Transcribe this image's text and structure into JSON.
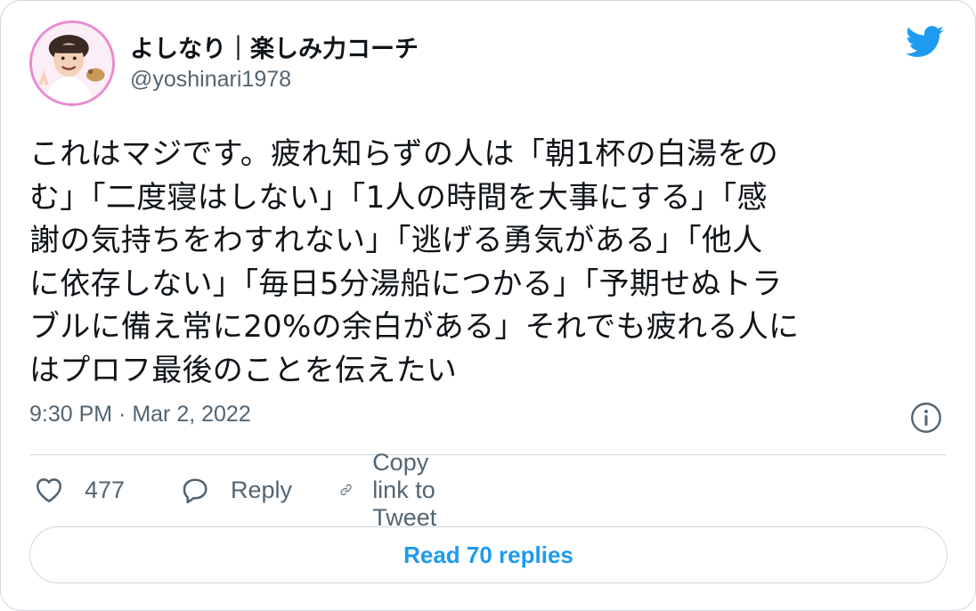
{
  "author": {
    "name": "よしなり｜楽しみ力コーチ",
    "handle": "@yoshinari1978"
  },
  "tweet": {
    "lines": [
      "これはマジです。疲れ知らずの人は「朝1杯の白湯をの",
      "む」「二度寝はしない」「1人の時間を大事にする」「感",
      "謝の気持ちをわすれない」「逃げる勇気がある」「他人",
      "に依存しない」「毎日5分湯船につかる」「予期せぬトラ",
      "ブルに備え常に20%の余白がある」それでも疲れる人に",
      "はプロフ最後のことを伝えたい"
    ],
    "timestamp": "9:30 PM · Mar 2, 2022"
  },
  "actions": {
    "like_count": "477",
    "reply_label": "Reply",
    "copy_label": "Copy link to Tweet"
  },
  "read_replies_label": "Read 70 replies",
  "colors": {
    "accent": "#1d9bf0",
    "text": "#0f1419",
    "muted": "#536471",
    "border": "#cfd9de",
    "avatar_ring": "#e98bd0"
  },
  "icons": [
    "twitter-bird-icon",
    "info-icon",
    "heart-icon",
    "reply-icon",
    "link-icon"
  ]
}
